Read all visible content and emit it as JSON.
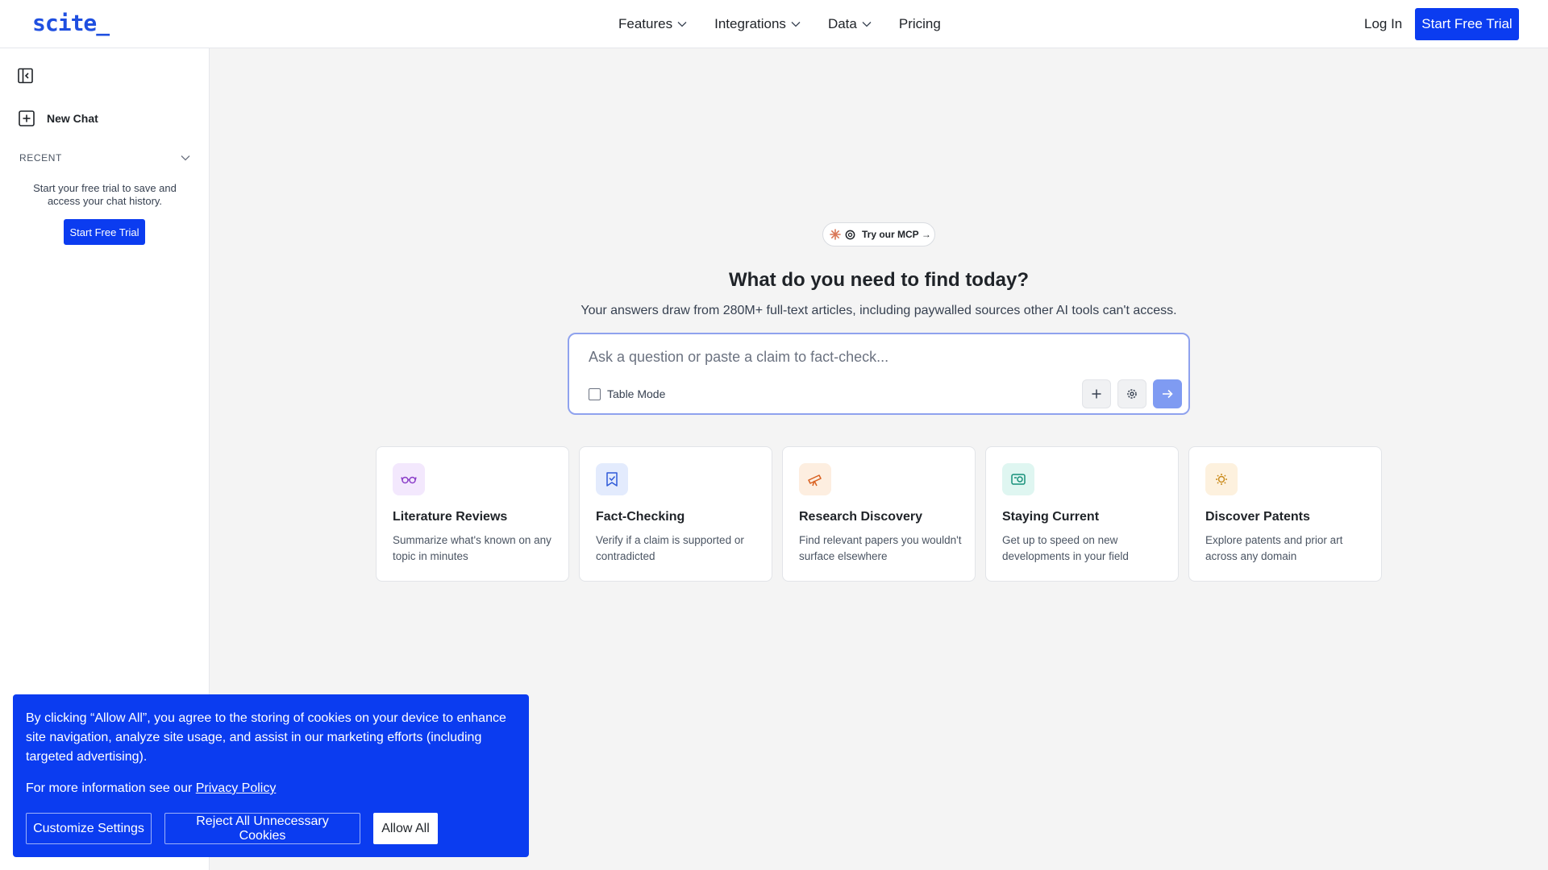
{
  "header": {
    "logo": "scite_",
    "nav": [
      {
        "label": "Features",
        "has_dropdown": true
      },
      {
        "label": "Integrations",
        "has_dropdown": true
      },
      {
        "label": "Data",
        "has_dropdown": true
      },
      {
        "label": "Pricing",
        "has_dropdown": false
      }
    ],
    "login_label": "Log In",
    "cta_label": "Start Free Trial"
  },
  "sidebar": {
    "collapse_icon": "sidebar-collapse-icon",
    "new_chat_label": "New Chat",
    "recent_label": "RECENT",
    "trial_text": "Start your free trial to save and access your chat history.",
    "cta_label": "Start Free Trial"
  },
  "main": {
    "mcp_label": "Try our MCP",
    "mcp_arrow": "→",
    "headline": "What do you need to find today?",
    "subline": "Your answers draw from 280M+ full-text articles, including paywalled sources other AI tools can't access.",
    "search": {
      "placeholder": "Ask a question or paste a claim to fact-check...",
      "value": "",
      "table_mode_label": "Table Mode",
      "table_mode_checked": false
    },
    "cards": [
      {
        "title": "Literature Reviews",
        "desc": "Summarize what's known on any topic in minutes",
        "icon": "glasses-icon",
        "bg": "#f3e8fd",
        "fg": "#8b3fc9"
      },
      {
        "title": "Fact-Checking",
        "desc": "Verify if a claim is supported or contradicted",
        "icon": "bookmark-check-icon",
        "bg": "#e3ebfd",
        "fg": "#2f5bd8"
      },
      {
        "title": "Research Discovery",
        "desc": "Find relevant papers you wouldn't surface elsewhere",
        "icon": "telescope-icon",
        "bg": "#fdeee0",
        "fg": "#d9601f"
      },
      {
        "title": "Staying Current",
        "desc": "Get up to speed on new developments in your field",
        "icon": "newspaper-icon",
        "bg": "#dff6f1",
        "fg": "#17907a"
      },
      {
        "title": "Discover Patents",
        "desc": "Explore patents and prior art across any domain",
        "icon": "patent-icon",
        "bg": "#fdf1de",
        "fg": "#c98a1a"
      }
    ]
  },
  "cookie": {
    "message": "By clicking “Allow All”, you agree to the storing of cookies on your device to enhance site navigation, analyze site usage, and assist in our marketing efforts (including targeted advertising).",
    "info_prefix": "For more information see our ",
    "privacy_link": "Privacy Policy",
    "customize_label": "Customize Settings",
    "reject_label": "Reject All Unnecessary Cookies",
    "allow_label": "Allow All"
  },
  "colors": {
    "brand_blue": "#0b3cf0",
    "send_button": "#7f9bf2",
    "search_border": "#8fa2ee"
  }
}
